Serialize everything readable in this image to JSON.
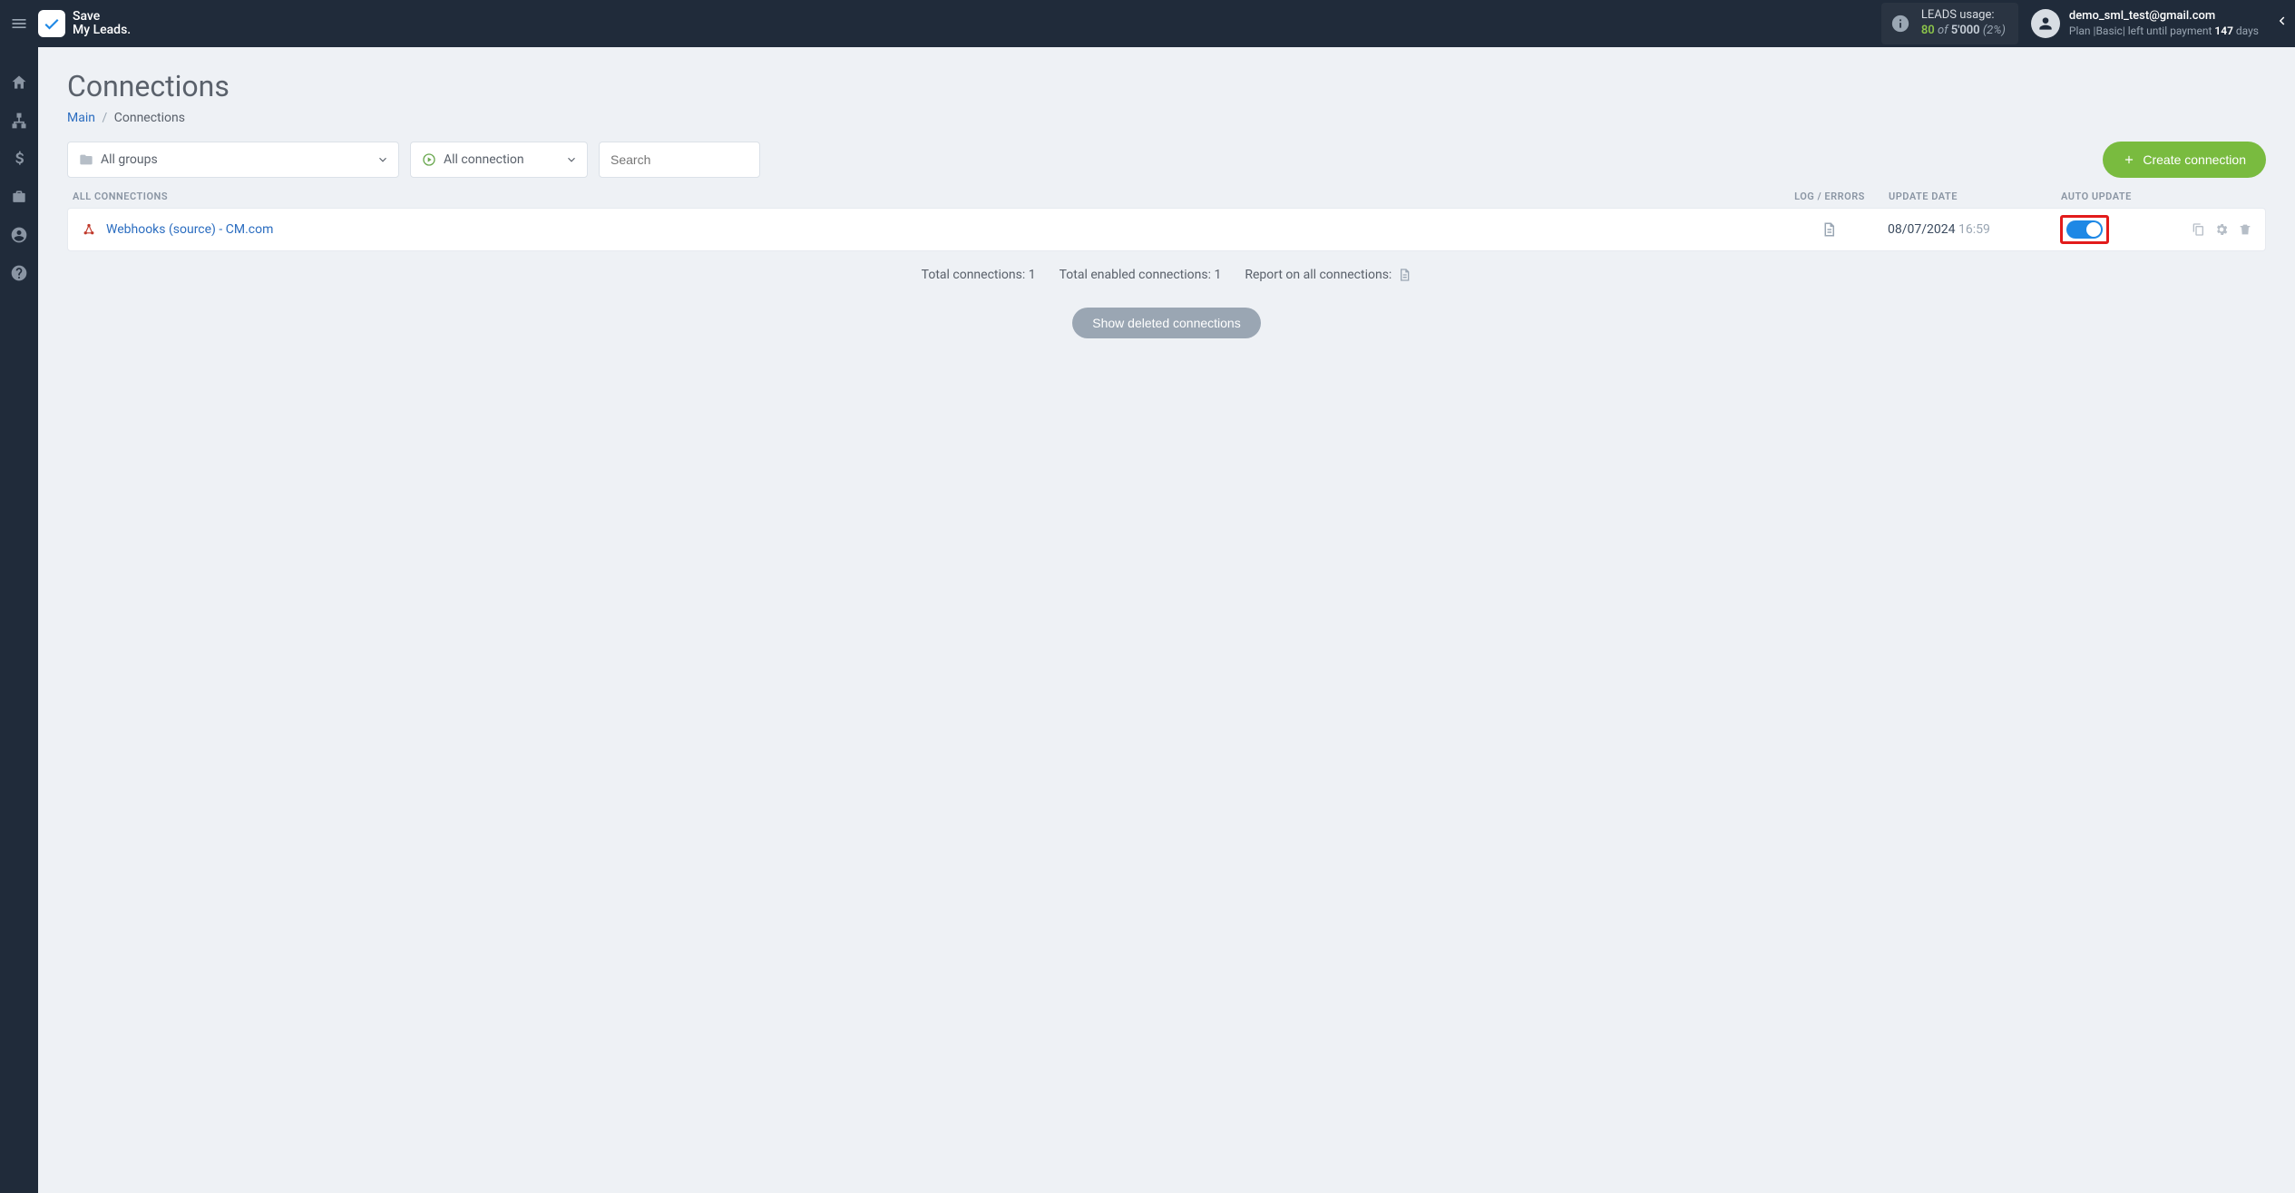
{
  "brand": {
    "line1": "Save",
    "line2": "My Leads."
  },
  "usage": {
    "label": "LEADS usage:",
    "used": "80",
    "of_word": "of",
    "limit": "5'000",
    "percent": "(2%)"
  },
  "account": {
    "email": "demo_sml_test@gmail.com",
    "plan_prefix": "Plan |",
    "plan_name": "Basic",
    "plan_mid": "| left until payment ",
    "days": "147",
    "days_suffix": " days"
  },
  "page": {
    "title": "Connections",
    "breadcrumb_main": "Main",
    "breadcrumb_current": "Connections"
  },
  "filters": {
    "groups_label": "All groups",
    "connection_label": "All connection",
    "search_placeholder": "Search"
  },
  "create_button": "Create connection",
  "columns": {
    "name": "ALL CONNECTIONS",
    "log": "LOG / ERRORS",
    "date": "UPDATE DATE",
    "auto": "AUTO UPDATE"
  },
  "rows": [
    {
      "name": "Webhooks (source) - CM.com",
      "date": "08/07/2024",
      "time": "16:59",
      "auto_update": true
    }
  ],
  "summary": {
    "total_label": "Total connections: ",
    "total_value": "1",
    "enabled_label": "Total enabled connections: ",
    "enabled_value": "1",
    "report_label": "Report on all connections: "
  },
  "show_deleted": "Show deleted connections"
}
